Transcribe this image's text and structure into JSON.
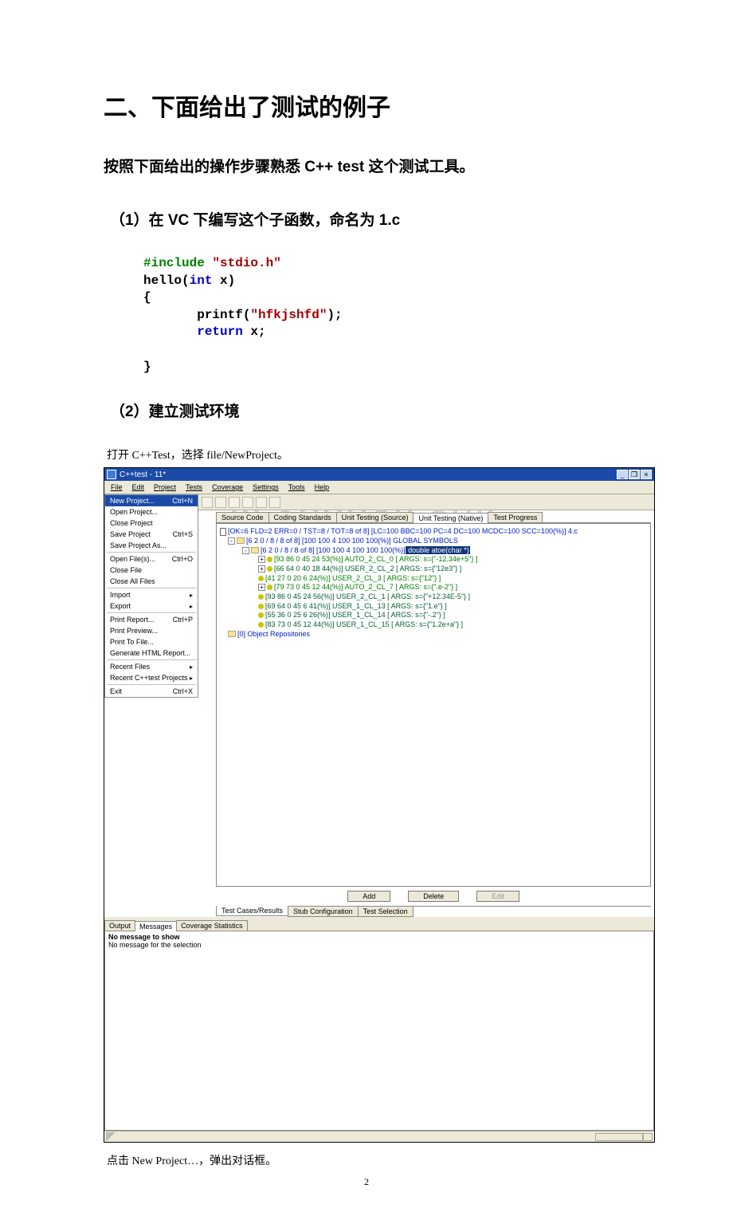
{
  "doc": {
    "h1": "二、下面给出了测试的例子",
    "h2": "按照下面给出的操作步骤熟悉 C++ test 这个测试工具。",
    "step1_title": "（1）在 VC 下编写这个子函数，命名为 1.c",
    "code": {
      "l1a": "#include",
      "l1b": " \"stdio.h\"",
      "l2a": "hello(",
      "l2b": "int",
      "l2c": " x)",
      "l3": "{",
      "l4a": "       printf(",
      "l4b": "\"hfkjshfd\"",
      "l4c": ");",
      "l5a": "       ",
      "l5b": "return",
      "l5c": " x;",
      "l6": "",
      "l7": "}"
    },
    "step2_title": "（2）建立测试环境",
    "body1": "打开 C++Test，选择 file/NewProject。",
    "body2": "点击 New Project…，弹出对话框。",
    "page_num": "2"
  },
  "app": {
    "title": "C++test - 11*",
    "win_min": "_",
    "win_max": "❐",
    "win_close": "×",
    "menubar": [
      "File",
      "Edit",
      "Project",
      "Tests",
      "Coverage",
      "Settings",
      "Tools",
      "Help"
    ],
    "bg_logo_a": "W.",
    "bg_logo_b": "UUUCX.CUII",
    "file_menu": [
      {
        "label": "New Project...",
        "accel": "Ctrl+N",
        "hl": true
      },
      {
        "label": "Open Project..."
      },
      {
        "label": "Close Project"
      },
      {
        "label": "Save Project",
        "accel": "Ctrl+S"
      },
      {
        "label": "Save Project As..."
      },
      {
        "sep": true
      },
      {
        "label": "Open File(s)...",
        "accel": "Ctrl+O"
      },
      {
        "label": "Close File"
      },
      {
        "label": "Close All Files"
      },
      {
        "sep": true
      },
      {
        "label": "Import",
        "sub": true
      },
      {
        "label": "Export",
        "sub": true
      },
      {
        "sep": true
      },
      {
        "label": "Print Report...",
        "accel": "Ctrl+P"
      },
      {
        "label": "Print Preview..."
      },
      {
        "label": "Print To File..."
      },
      {
        "label": "Generate HTML Report..."
      },
      {
        "sep": true
      },
      {
        "label": "Recent Files",
        "sub": true
      },
      {
        "label": "Recent C++test Projects",
        "sub": true
      },
      {
        "sep": true
      },
      {
        "label": "Exit",
        "accel": "Ctrl+X"
      }
    ],
    "tabs_top": [
      "Source Code",
      "Coding Standards",
      "Unit Testing (Source)",
      "Unit Testing (Native)",
      "Test Progress"
    ],
    "tabs_top_active": 3,
    "tree": {
      "root": "[OK=6 FLD=2 ERR=0 / TST=8 / TOT=8 of 8]  [LC=100 BBC=100 PC=4 DC=100 MCDC=100 SCC=100(%)] 4.c",
      "n1": "[6 2 0 / 8 / 8 of 8]  [100 100 4 100 100 100(%)] GLOBAL SYMBOLS",
      "n2_a": "[6 2 0 / 8 / 8 of 8]  [100 100 4 100 100 100(%)]",
      "n2_b": " double atoe(char *)",
      "rows": [
        {
          "t": "[93 86 0 45 24 53(%)] AUTO_2_CL_0    [ ARGS: s={\"-12.34e+5\"} ]",
          "c": "green",
          "b": "+"
        },
        {
          "t": "[66 64 0 40 18 44(%)] USER_2_CL_2    [ ARGS: s={\"12e3\"} ]",
          "c": "dgreen",
          "b": "+"
        },
        {
          "t": "[41 27 0 20 6 24(%)] USER_2_CL_3    [ ARGS: s={\"12\"} ]",
          "c": "green",
          "b": ""
        },
        {
          "t": "[79 73 0 45 12 44(%)] AUTO_2_CL_7    [ ARGS: s={\".e-2\"} ]",
          "c": "green",
          "b": "+"
        },
        {
          "t": "[93 86 0 45 24 56(%)] USER_2_CL_1    [ ARGS: s={\"+12.34E-5\"} ]",
          "c": "dgreen",
          "b": ""
        },
        {
          "t": "[69 64 0 45 6 41(%)] USER_1_CL_13   [ ARGS: s={\"1.e\"} ]",
          "c": "dgreen",
          "b": ""
        },
        {
          "t": "[55 36 0 25 6 26(%)] USER_1_CL_14   [ ARGS: s={\"-.2\"} ]",
          "c": "dgreen",
          "b": ""
        },
        {
          "t": "[83 73 0 45 12 44(%)] USER_1_CL_15   [ ARGS: s={\"1.2e+a\"} ]",
          "c": "dgreen",
          "b": ""
        }
      ],
      "repo": "[0] Object Repositories"
    },
    "buttons": {
      "add": "Add",
      "delete": "Delete",
      "edit": "Edit"
    },
    "tabs_bottom": [
      "Test Cases/Results",
      "Stub Configuration",
      "Test Selection"
    ],
    "tabs_bottom_active": 0,
    "lower_tabs": [
      "Output",
      "Messages",
      "Coverage Statistics"
    ],
    "lower_tabs_active": 1,
    "lower_l1": "No message to show",
    "lower_l2": "No message for the selection"
  }
}
